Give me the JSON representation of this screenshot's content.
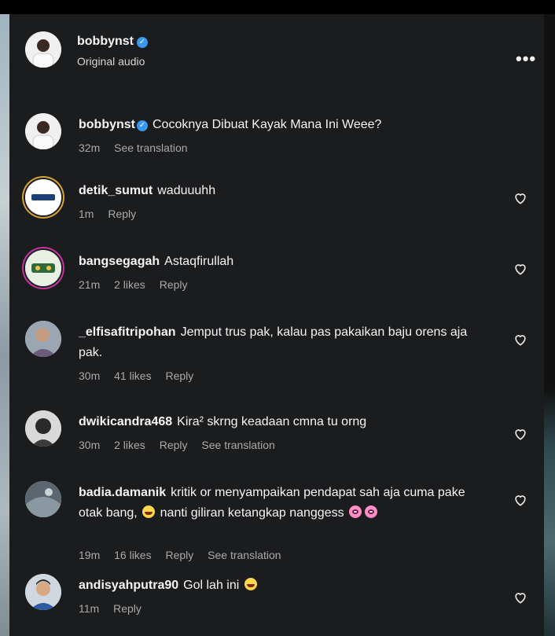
{
  "header": {
    "username": "bobbynst",
    "audio": "Original audio",
    "more": "•••"
  },
  "colors": {
    "verified": "#3897f0",
    "ring_gold": "#d4a23a",
    "ring_purple": "#c0359e"
  },
  "comments": [
    {
      "user": "bobbynst",
      "verified": true,
      "text": "Cocoknya Dibuat Kayak Mana Ini Weee?",
      "time": "32m",
      "likes": "",
      "reply": "",
      "see_translation": "See translation",
      "heart": false
    },
    {
      "user": "detik_sumut",
      "text": "waduuuhh",
      "time": "1m",
      "likes": "",
      "reply": "Reply",
      "see_translation": "",
      "heart": true
    },
    {
      "user": "bangsegagah",
      "text": "Astaqfirullah",
      "time": "21m",
      "likes": "2 likes",
      "reply": "Reply",
      "see_translation": "",
      "heart": true
    },
    {
      "user": "_elfisafitripohan",
      "text": "Jemput trus pak, kalau pas pakaikan baju orens aja pak.",
      "time": "30m",
      "likes": "41 likes",
      "reply": "Reply",
      "see_translation": "",
      "heart": true
    },
    {
      "user": "dwikicandra468",
      "text": "Kira² skrng keadaan cmna tu orng",
      "time": "30m",
      "likes": "2 likes",
      "reply": "Reply",
      "see_translation": "See translation",
      "heart": true
    },
    {
      "user": "badia.damanik",
      "text_part1": "kritik or menyampaikan pendapat sah aja cuma pake otak bang,",
      "text_part2": "nanti giliran ketangkap nanggess",
      "time": "19m",
      "likes": "16 likes",
      "reply": "Reply",
      "see_translation": "See translation",
      "heart": true
    },
    {
      "user": "andisyahputra90",
      "text": "Gol lah ini",
      "time": "11m",
      "likes": "",
      "reply": "Reply",
      "see_translation": "",
      "heart": true
    }
  ]
}
